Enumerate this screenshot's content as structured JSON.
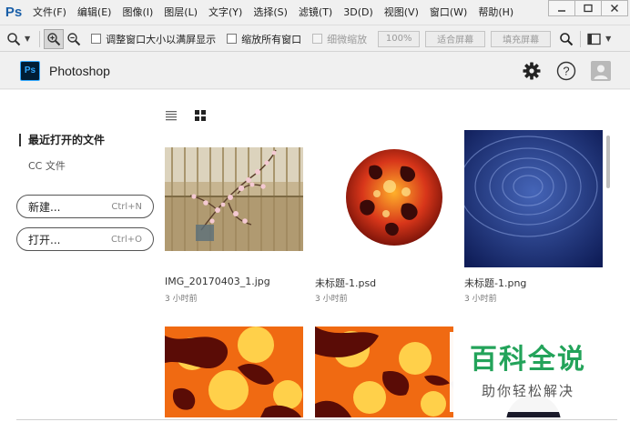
{
  "menubar": {
    "logo": "Ps",
    "items": [
      "文件(F)",
      "编辑(E)",
      "图像(I)",
      "图层(L)",
      "文字(Y)",
      "选择(S)",
      "滤镜(T)",
      "3D(D)",
      "视图(V)",
      "窗口(W)",
      "帮助(H)"
    ]
  },
  "options": {
    "checkbox_resize": "调整窗口大小以满屏显示",
    "checkbox_zoom_all": "缩放所有窗口",
    "checkbox_scrubby": "细微缩放",
    "btn_100": "100%",
    "btn_fit": "适合屏幕",
    "btn_fill": "填充屏幕"
  },
  "header": {
    "badge": "Ps",
    "app_name": "Photoshop"
  },
  "sidebar": {
    "recent": "最近打开的文件",
    "cc_files": "CC 文件",
    "new_label": "新建...",
    "new_shortcut": "Ctrl+N",
    "open_label": "打开...",
    "open_shortcut": "Ctrl+O"
  },
  "files": [
    {
      "name": "IMG_20170403_1.jpg",
      "time": "3 小时前"
    },
    {
      "name": "未标题-1.psd",
      "time": "3 小时前"
    },
    {
      "name": "未标题-1.png",
      "time": "3 小时前"
    }
  ],
  "watermark": {
    "top": "百科全说",
    "bottom": "助你轻松解决"
  },
  "colors": {
    "accent": "#31a8ff",
    "watermark_green": "#23a35a"
  }
}
